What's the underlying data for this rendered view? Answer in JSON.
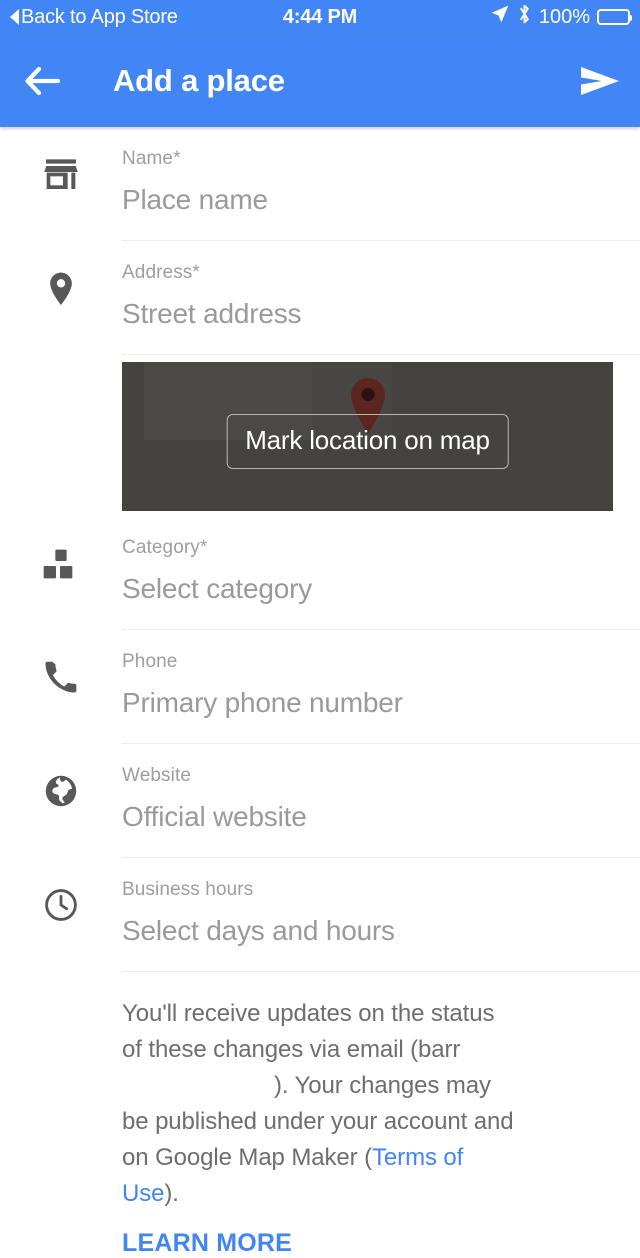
{
  "status_bar": {
    "back_label": "Back to App Store",
    "time": "4:44 PM",
    "battery_percent": "100%",
    "icons": [
      "location-arrow-icon",
      "bluetooth-icon",
      "battery-icon"
    ]
  },
  "app_bar": {
    "title": "Add a place",
    "back_icon": "arrow-back-icon",
    "submit_icon": "send-icon"
  },
  "theme": {
    "accent": "#4285F4",
    "map_background": "#45433f",
    "pin_color": "#5c2520",
    "label_color": "#9e9e9e",
    "placeholder_color": "#9a9a9a"
  },
  "fields": [
    {
      "icon": "store-icon",
      "label": "Name*",
      "placeholder": "Place name"
    },
    {
      "icon": "location-pin-icon",
      "label": "Address*",
      "placeholder": "Street address"
    },
    {
      "icon": "category-icon",
      "label": "Category*",
      "placeholder": "Select category"
    },
    {
      "icon": "phone-icon",
      "label": "Phone",
      "placeholder": "Primary phone number"
    },
    {
      "icon": "globe-icon",
      "label": "Website",
      "placeholder": "Official website"
    },
    {
      "icon": "clock-icon",
      "label": "Business hours",
      "placeholder": "Select days and hours"
    }
  ],
  "map": {
    "button_label": "Mark location on map",
    "pin_icon": "map-pin-icon"
  },
  "footer": {
    "text_part1": "You'll receive updates on the status of these changes via email (barr",
    "text_part2": "). Your changes may be published under your account and on Google Map Maker (",
    "terms_link": "Terms of Use",
    "text_part3": ").",
    "learn_more": "LEARN MORE"
  }
}
